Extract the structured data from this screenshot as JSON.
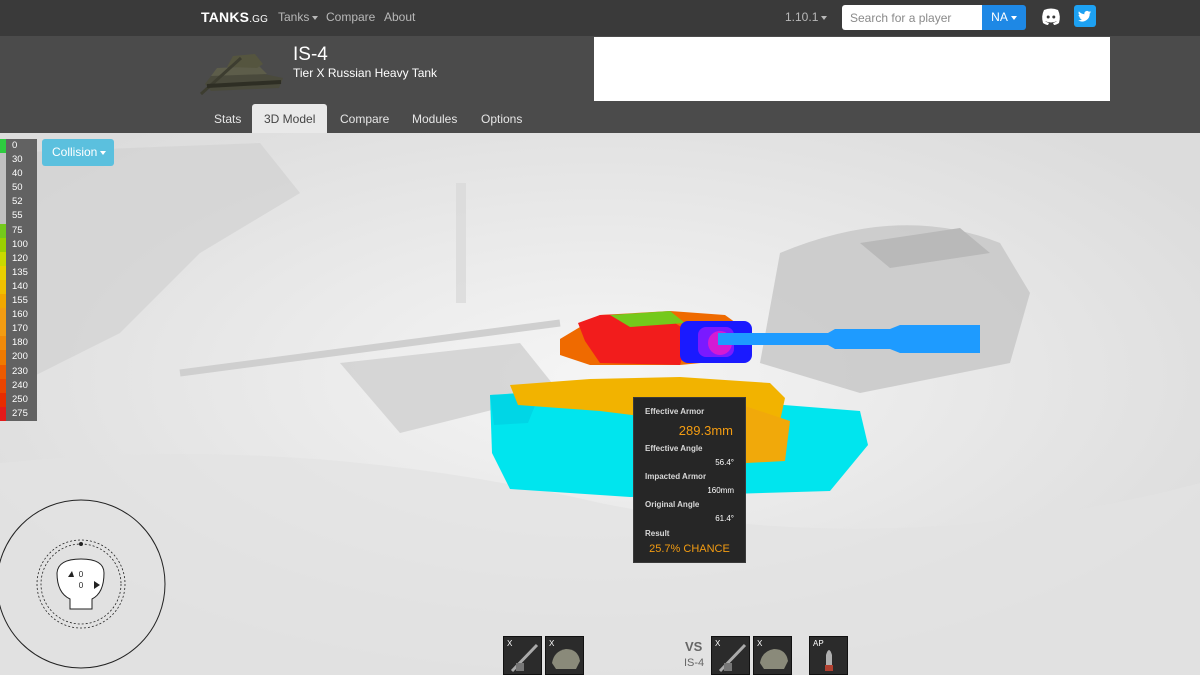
{
  "navbar": {
    "brand": "TANKS",
    "brand_suffix": ".GG",
    "links": [
      {
        "label": "Tanks",
        "dropdown": true
      },
      {
        "label": "Compare",
        "dropdown": false
      },
      {
        "label": "About",
        "dropdown": false
      }
    ],
    "version": "1.10.1",
    "search_placeholder": "Search for a player",
    "region": "NA"
  },
  "header": {
    "tank_name": "IS-4",
    "tank_subtitle": "Tier X Russian Heavy Tank",
    "tabs": [
      "Stats",
      "3D Model",
      "Compare",
      "Modules",
      "Options"
    ],
    "active_tab": "3D Model"
  },
  "viewer": {
    "mode_button": "Collision",
    "legend": [
      {
        "value": "0",
        "color": "#2ecc40"
      },
      {
        "value": "30",
        "color": "#c0c0c0"
      },
      {
        "value": "40",
        "color": "#c0c0c0"
      },
      {
        "value": "50",
        "color": "#c0c0c0"
      },
      {
        "value": "52",
        "color": "#c0c0c0"
      },
      {
        "value": "55",
        "color": "#c0c0c0"
      },
      {
        "value": "75",
        "color": "#74c91b"
      },
      {
        "value": "100",
        "color": "#9bd000"
      },
      {
        "value": "120",
        "color": "#c9d900"
      },
      {
        "value": "135",
        "color": "#e8d000"
      },
      {
        "value": "140",
        "color": "#f0c000"
      },
      {
        "value": "155",
        "color": "#f2a800"
      },
      {
        "value": "160",
        "color": "#f39c12"
      },
      {
        "value": "170",
        "color": "#f39c12"
      },
      {
        "value": "180",
        "color": "#f08a0a"
      },
      {
        "value": "200",
        "color": "#ef7a00"
      },
      {
        "value": "230",
        "color": "#ec5a00"
      },
      {
        "value": "240",
        "color": "#ea4400"
      },
      {
        "value": "250",
        "color": "#e82c00"
      },
      {
        "value": "275",
        "color": "#e41a1a"
      }
    ],
    "tooltip": {
      "effective_armor_label": "Effective Armor",
      "effective_armor_value": "289.3mm",
      "effective_angle_label": "Effective Angle",
      "effective_angle_value": "56.4°",
      "impacted_armor_label": "Impacted Armor",
      "impacted_armor_value": "160mm",
      "original_angle_label": "Original Angle",
      "original_angle_value": "61.4°",
      "result_label": "Result",
      "result_value": "25.7% CHANCE"
    },
    "minimap": {
      "value_top": "0",
      "value_bottom": "0"
    },
    "bottom": {
      "left_slots": [
        {
          "tag": "X",
          "icon": "gun-icon"
        },
        {
          "tag": "X",
          "icon": "turret-icon"
        }
      ],
      "vs_label": "VS",
      "vs_tank": "IS-4",
      "right_slots": [
        {
          "tag": "X",
          "icon": "gun-icon"
        },
        {
          "tag": "X",
          "icon": "turret-icon"
        }
      ],
      "ammo": {
        "tag": "AP",
        "icon": "shell-icon"
      }
    }
  }
}
